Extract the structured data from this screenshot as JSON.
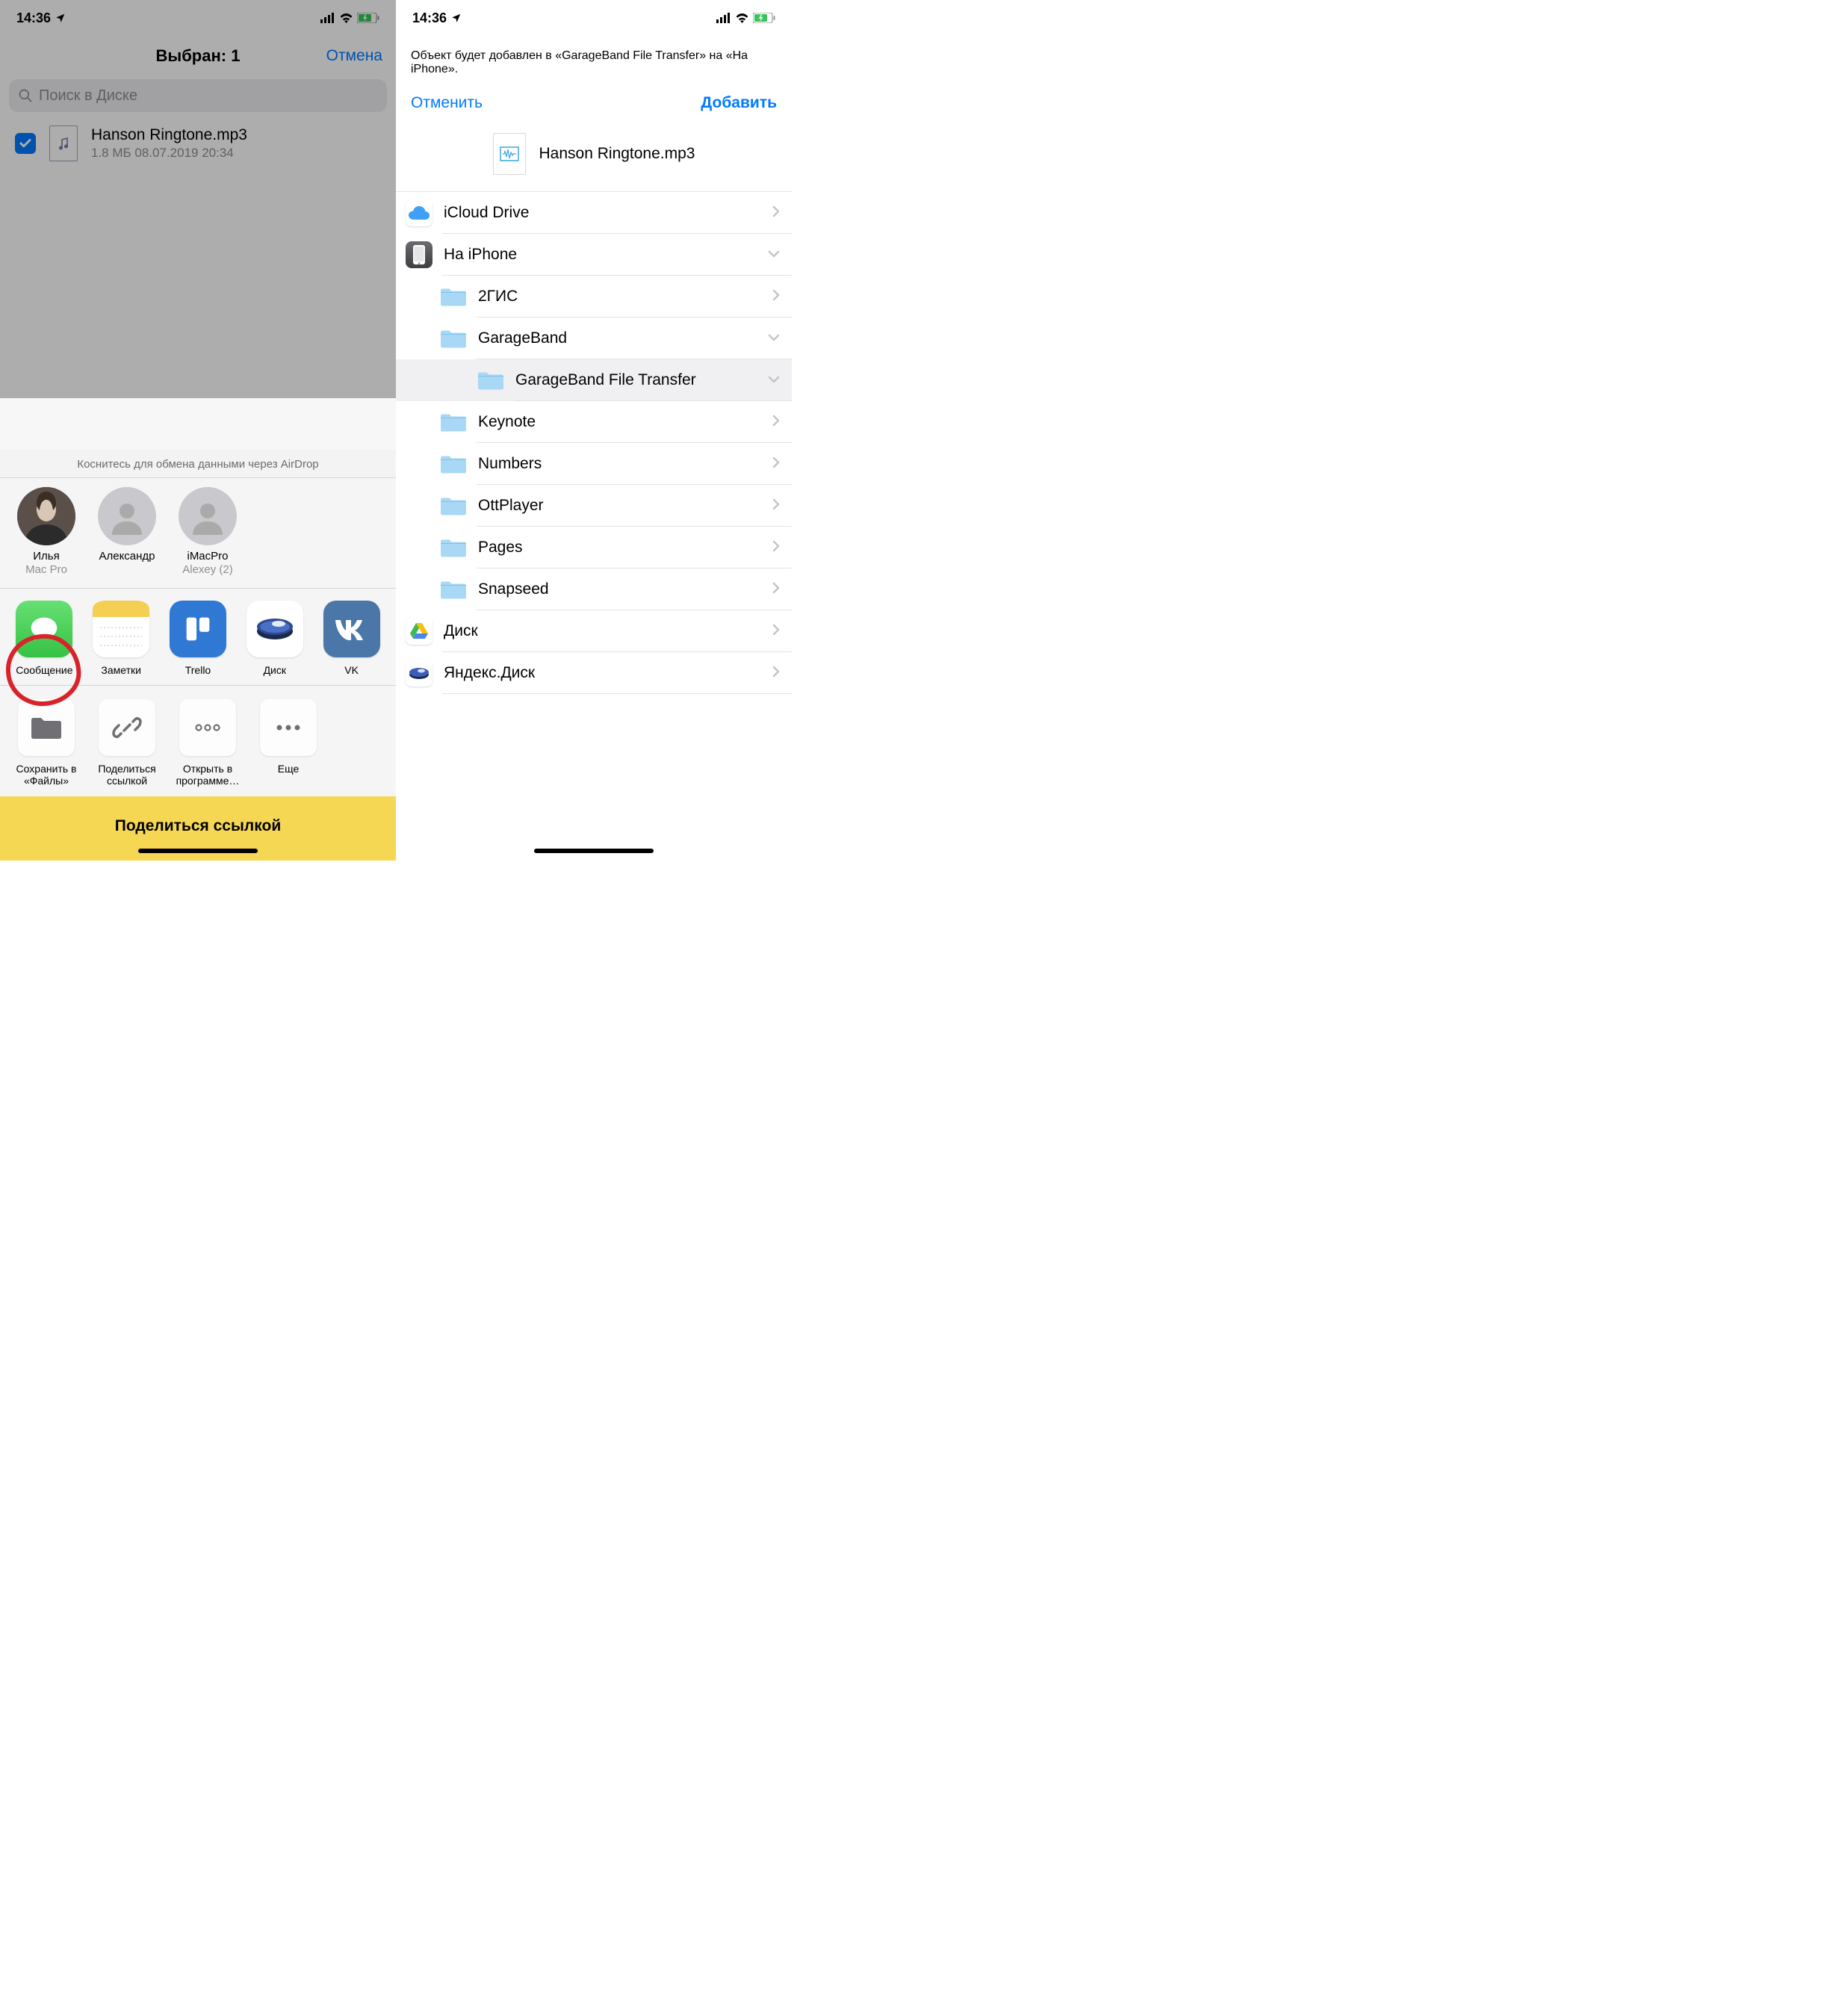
{
  "statusbar": {
    "time": "14:36"
  },
  "left": {
    "header_title": "Выбран: 1",
    "cancel": "Отмена",
    "search_placeholder": "Поиск в Диске",
    "file": {
      "name": "Hanson Ringtone.mp3",
      "meta": "1.8 МБ   08.07.2019 20:34"
    },
    "airdrop_hint": "Коснитесь для обмена данными через AirDrop",
    "airdrop": [
      {
        "name": "Илья",
        "sub": "Mac Pro"
      },
      {
        "name": "Александр",
        "sub": ""
      },
      {
        "name": "iMacPro",
        "sub": "Alexey (2)"
      }
    ],
    "apps": [
      {
        "label": "Сообщение",
        "color": "#4cd964"
      },
      {
        "label": "Заметки",
        "color": "#fff"
      },
      {
        "label": "Trello",
        "color": "#2f79d4"
      },
      {
        "label": "Диск",
        "color": "#fff"
      },
      {
        "label": "VK",
        "color": "#4a76a8"
      }
    ],
    "actions": [
      {
        "label": "Сохранить в «Файлы»"
      },
      {
        "label": "Поделиться ссылкой"
      },
      {
        "label": "Открыть в программе…"
      },
      {
        "label": "Еще"
      }
    ],
    "share_link_button": "Поделиться ссылкой"
  },
  "right": {
    "subtitle": "Объект будет добавлен в «GarageBand File Transfer» на «На iPhone».",
    "nav_cancel": "Отменить",
    "nav_add": "Добавить",
    "file_name": "Hanson Ringtone.mp3",
    "locations": [
      {
        "label": "iCloud Drive",
        "icon": "icloud",
        "indent": 0,
        "chev": "right"
      },
      {
        "label": "На iPhone",
        "icon": "iphone",
        "indent": 0,
        "chev": "down"
      },
      {
        "label": "2ГИС",
        "icon": "folder",
        "indent": 1,
        "chev": "right"
      },
      {
        "label": "GarageBand",
        "icon": "folder",
        "indent": 1,
        "chev": "down"
      },
      {
        "label": "GarageBand File Transfer",
        "icon": "folder",
        "indent": 2,
        "chev": "down",
        "selected": true
      },
      {
        "label": "Keynote",
        "icon": "folder",
        "indent": 1,
        "chev": "right"
      },
      {
        "label": "Numbers",
        "icon": "folder",
        "indent": 1,
        "chev": "right"
      },
      {
        "label": "OttPlayer",
        "icon": "folder",
        "indent": 1,
        "chev": "right"
      },
      {
        "label": "Pages",
        "icon": "folder",
        "indent": 1,
        "chev": "right"
      },
      {
        "label": "Snapseed",
        "icon": "folder",
        "indent": 1,
        "chev": "right"
      },
      {
        "label": "Диск",
        "icon": "gdrive",
        "indent": 0,
        "chev": "right"
      },
      {
        "label": "Яндекс.Диск",
        "icon": "yadisk",
        "indent": 0,
        "chev": "right"
      }
    ]
  }
}
